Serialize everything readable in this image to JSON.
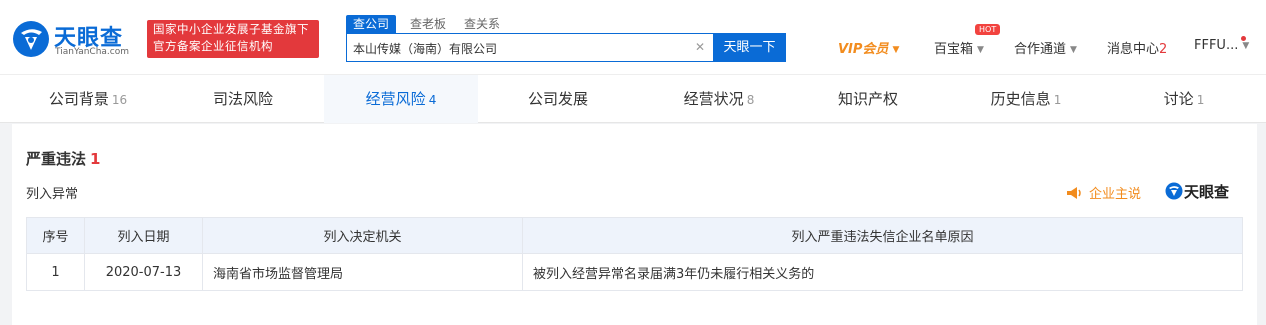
{
  "header": {
    "logo_name": "天眼查",
    "logo_domain": "TianYanCha.com",
    "org_badge": [
      "国家中小企业发展子基金旗下",
      "官方备案企业征信机构"
    ],
    "search_tabs": [
      "查公司",
      "查老板",
      "查关系"
    ],
    "search_value": "本山传媒（海南）有限公司",
    "search_button": "天眼一下",
    "nav": {
      "vip": "VIP会员",
      "treasure": "百宝箱",
      "hot": "HOT",
      "cooperation": "合作通道",
      "messages": "消息中心",
      "message_count": "2",
      "user": "FFFU..."
    }
  },
  "tabs": [
    {
      "label": "公司背景",
      "count": "16"
    },
    {
      "label": "司法风险",
      "count": ""
    },
    {
      "label": "经营风险",
      "count": "4"
    },
    {
      "label": "公司发展",
      "count": ""
    },
    {
      "label": "经营状况",
      "count": "8"
    },
    {
      "label": "知识产权",
      "count": ""
    },
    {
      "label": "历史信息",
      "count": "1"
    },
    {
      "label": "讨论",
      "count": "1"
    }
  ],
  "section": {
    "title": "严重违法",
    "count": "1",
    "subtitle": "列入异常",
    "speak_label": "企业主说",
    "watermark": "天眼查"
  },
  "table": {
    "columns": [
      "序号",
      "列入日期",
      "列入决定机关",
      "列入严重违法失信企业名单原因"
    ],
    "rows": [
      [
        "1",
        "2020-07-13",
        "海南省市场监督管理局",
        "被列入经营异常名录届满3年仍未履行相关义务的"
      ]
    ]
  },
  "colors": {
    "brand_blue": "#0a6bd6",
    "badge_red": "#e3393c",
    "vip_orange": "#f28c1e",
    "table_header_bg": "#eef3fb"
  }
}
